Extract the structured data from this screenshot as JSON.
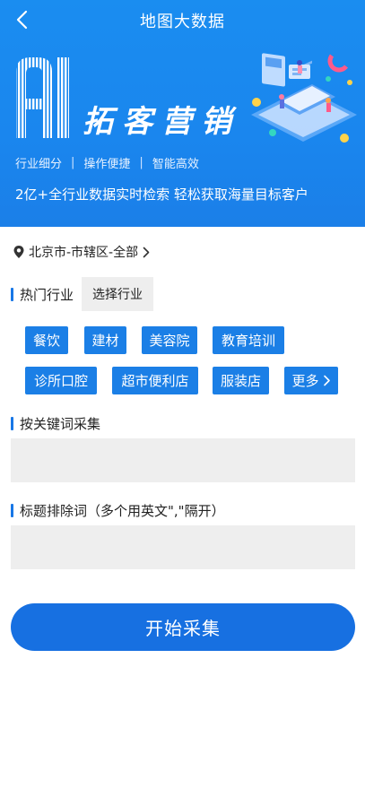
{
  "header": {
    "title": "地图大数据"
  },
  "banner": {
    "logo_text": "AI",
    "slogan": "拓客营销",
    "features": [
      "行业细分",
      "操作便捷",
      "智能高效"
    ],
    "subtitle": "2亿+全行业数据实时检索  轻松获取海量目标客户"
  },
  "location": {
    "text": "北京市-市辖区-全部"
  },
  "hot_industry": {
    "heading": "热门行业",
    "select_label": "选择行业",
    "tags": [
      "餐饮",
      "建材",
      "美容院",
      "教育培训",
      "诊所口腔",
      "超市便利店",
      "服装店"
    ],
    "more_label": "更多"
  },
  "keywords": {
    "heading": "按关键词采集",
    "value": "",
    "placeholder": ""
  },
  "exclude": {
    "heading": "标题排除词（多个用英文\",\"隔开）",
    "value": "",
    "placeholder": ""
  },
  "actions": {
    "start_label": "开始采集"
  },
  "colors": {
    "banner_blue": "#1a8df0",
    "tag_blue": "#1b7fe6",
    "button_blue": "#1770e1",
    "field_gray": "#eeeeee"
  }
}
